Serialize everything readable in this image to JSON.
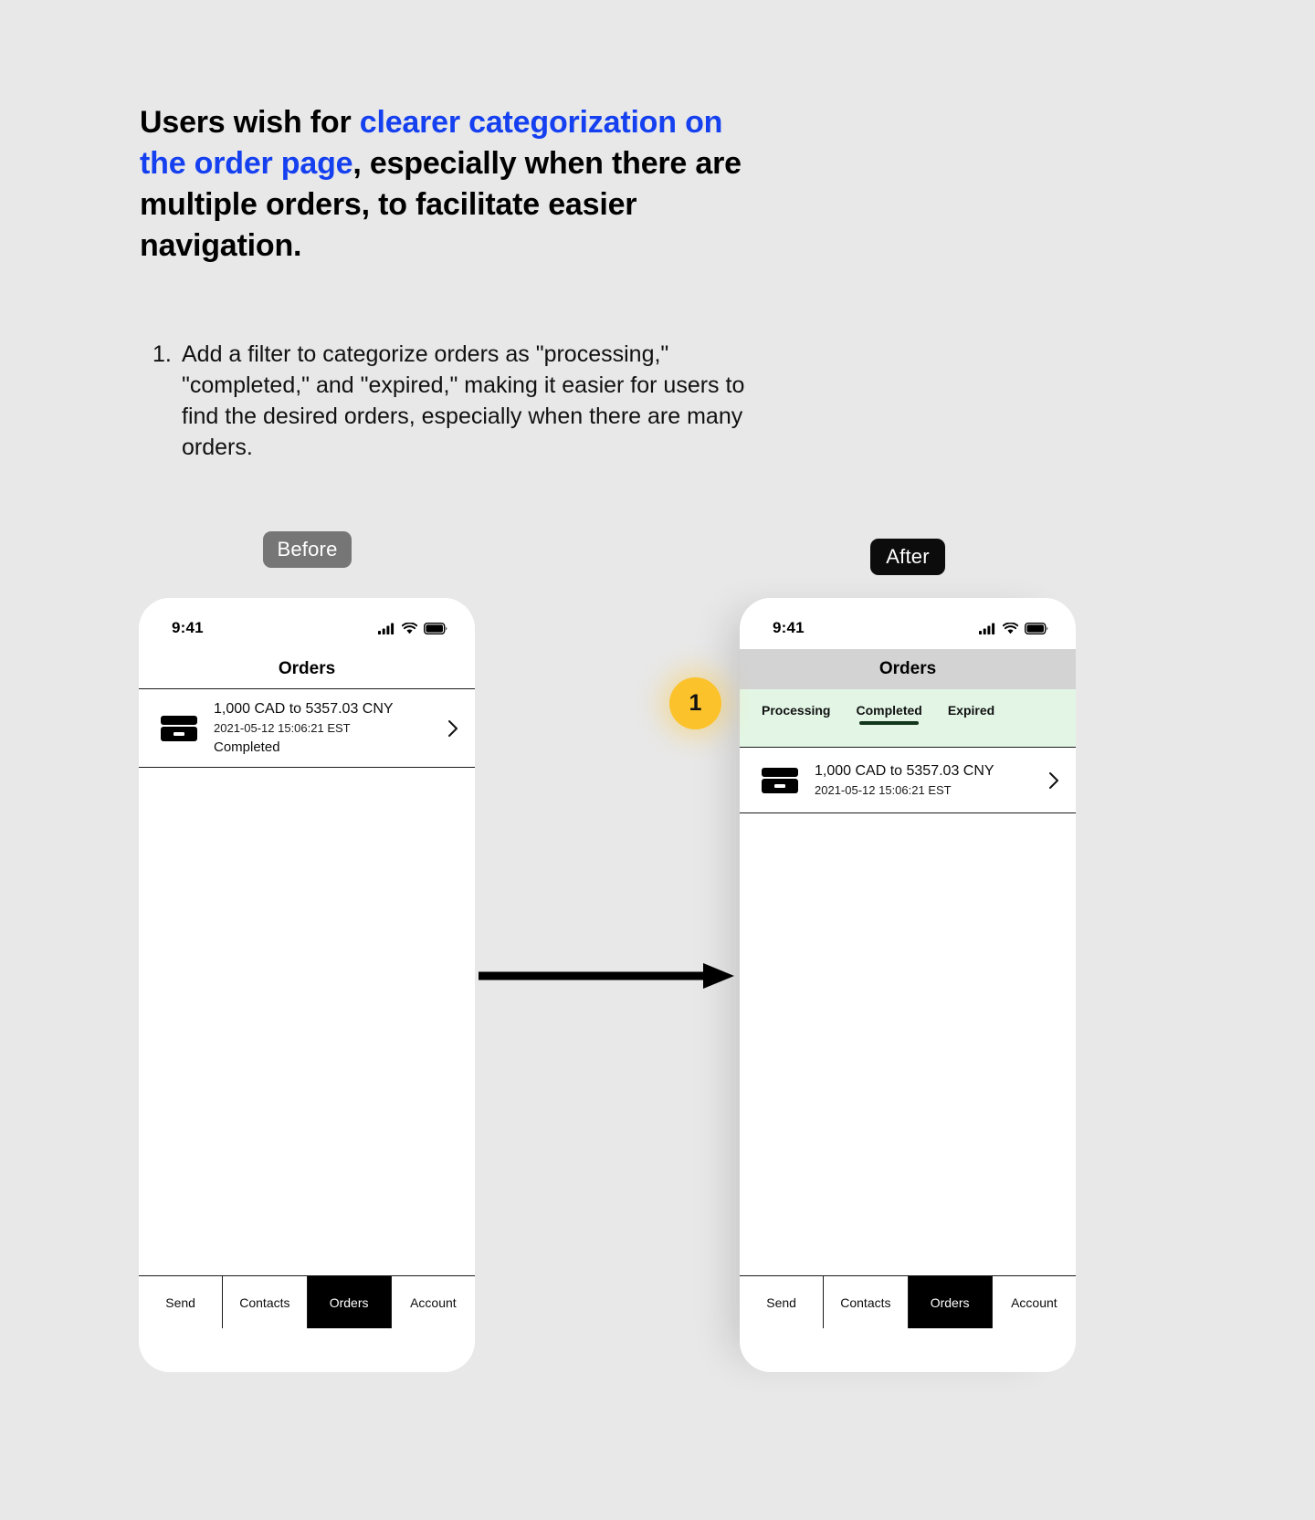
{
  "headline": {
    "part1": "Users wish for ",
    "highlight": "clearer categorization on the order page",
    "part2": ", especially when there are multiple orders, to facilitate easier navigation.",
    "highlight_color": "#1540f0"
  },
  "recommendations": [
    {
      "number": "1.",
      "text": "Add a filter to categorize orders as \"processing,\" \"completed,\" and \"expired,\" making it easier for users to find the desired orders, especially when there are many orders."
    }
  ],
  "labels": {
    "before": "Before",
    "after": "After",
    "before_bg": "#767676",
    "after_bg": "#0c0c0c"
  },
  "step_badge": {
    "number": "1",
    "color": "#fcc22c"
  },
  "before_phone": {
    "status": {
      "time": "9:41",
      "cellular_icon": "signal-bars-icon",
      "wifi_icon": "wifi-icon",
      "battery_icon": "battery-icon"
    },
    "nav_title": "Orders",
    "orders": [
      {
        "icon": "credit-card-icon",
        "title": "1,000 CAD to 5357.03 CNY",
        "date": "2021-05-12 15:06:21 EST",
        "status": "Completed",
        "chevron": "chevron-right-icon"
      }
    ],
    "tabbar": [
      {
        "label": "Send",
        "active": false
      },
      {
        "label": "Contacts",
        "active": false
      },
      {
        "label": "Orders",
        "active": true
      },
      {
        "label": "Account",
        "active": false
      }
    ]
  },
  "after_phone": {
    "status": {
      "time": "9:41",
      "cellular_icon": "signal-bars-icon",
      "wifi_icon": "wifi-icon",
      "battery_icon": "battery-icon"
    },
    "nav_title": "Orders",
    "nav_bg": "#d3d3d3",
    "filter_bg": "#e3f6e6",
    "filters": [
      {
        "label": "Processing",
        "selected": false
      },
      {
        "label": "Completed",
        "selected": true
      },
      {
        "label": "Expired",
        "selected": false
      }
    ],
    "orders": [
      {
        "icon": "credit-card-icon",
        "title": "1,000 CAD to 5357.03 CNY",
        "date": "2021-05-12 15:06:21 EST",
        "chevron": "chevron-right-icon"
      }
    ],
    "tabbar": [
      {
        "label": "Send",
        "active": false
      },
      {
        "label": "Contacts",
        "active": false
      },
      {
        "label": "Orders",
        "active": true
      },
      {
        "label": "Account",
        "active": false
      }
    ]
  }
}
